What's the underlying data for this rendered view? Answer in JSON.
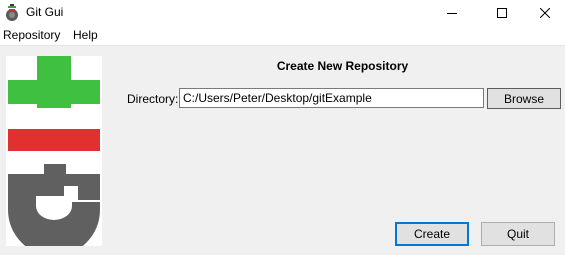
{
  "window": {
    "title": "Git Gui",
    "minimize_icon": "minimize-icon",
    "maximize_icon": "maximize-icon",
    "close_icon": "close-icon"
  },
  "menubar": {
    "items": [
      {
        "label": "Repository"
      },
      {
        "label": "Help"
      }
    ]
  },
  "logo": {
    "icon": "git-logo",
    "colors": {
      "plus": "#40c040",
      "minus": "#e03030",
      "glyph": "#606060"
    }
  },
  "dialog": {
    "heading": "Create New Repository",
    "directory_label": "Directory:",
    "directory_value": "C:/Users/Peter/Desktop/gitExample",
    "browse_label": "Browse",
    "create_label": "Create",
    "quit_label": "Quit"
  },
  "colors": {
    "titlebar_bg": "#ffffff",
    "window_bg": "#f0f0f0",
    "focus_accent": "#0078d7"
  }
}
